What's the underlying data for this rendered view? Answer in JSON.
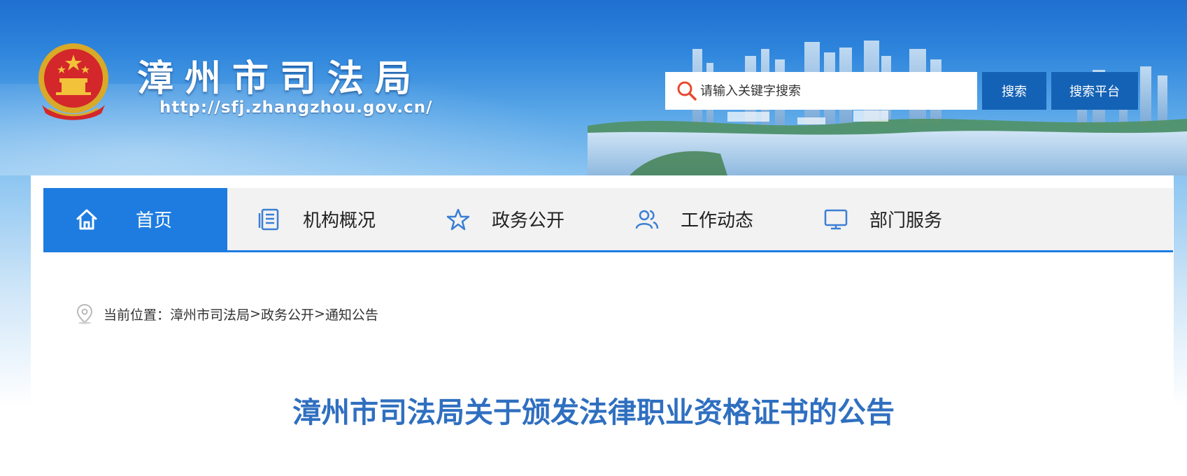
{
  "header": {
    "site_title": "漳州市司法局",
    "site_url": "http://sfj.zhangzhou.gov.cn/",
    "search": {
      "placeholder": "请输入关键字搜索",
      "search_button": "搜索",
      "platform_button": "搜索平台"
    }
  },
  "nav": {
    "items": [
      {
        "label": "首页",
        "icon": "home-icon",
        "active": true
      },
      {
        "label": "机构概况",
        "icon": "document-icon",
        "active": false
      },
      {
        "label": "政务公开",
        "icon": "star-icon",
        "active": false
      },
      {
        "label": "工作动态",
        "icon": "users-icon",
        "active": false
      },
      {
        "label": "部门服务",
        "icon": "monitor-icon",
        "active": false
      }
    ]
  },
  "breadcrumb": {
    "prefix": "当前位置：",
    "items": [
      "漳州市司法局",
      "政务公开",
      "通知公告"
    ],
    "separator": ">"
  },
  "article": {
    "title": "漳州市司法局关于颁发法律职业资格证书的公告"
  },
  "colors": {
    "accent": "#1e7ce0",
    "button": "#1462b5",
    "title": "#2f6fc0"
  }
}
